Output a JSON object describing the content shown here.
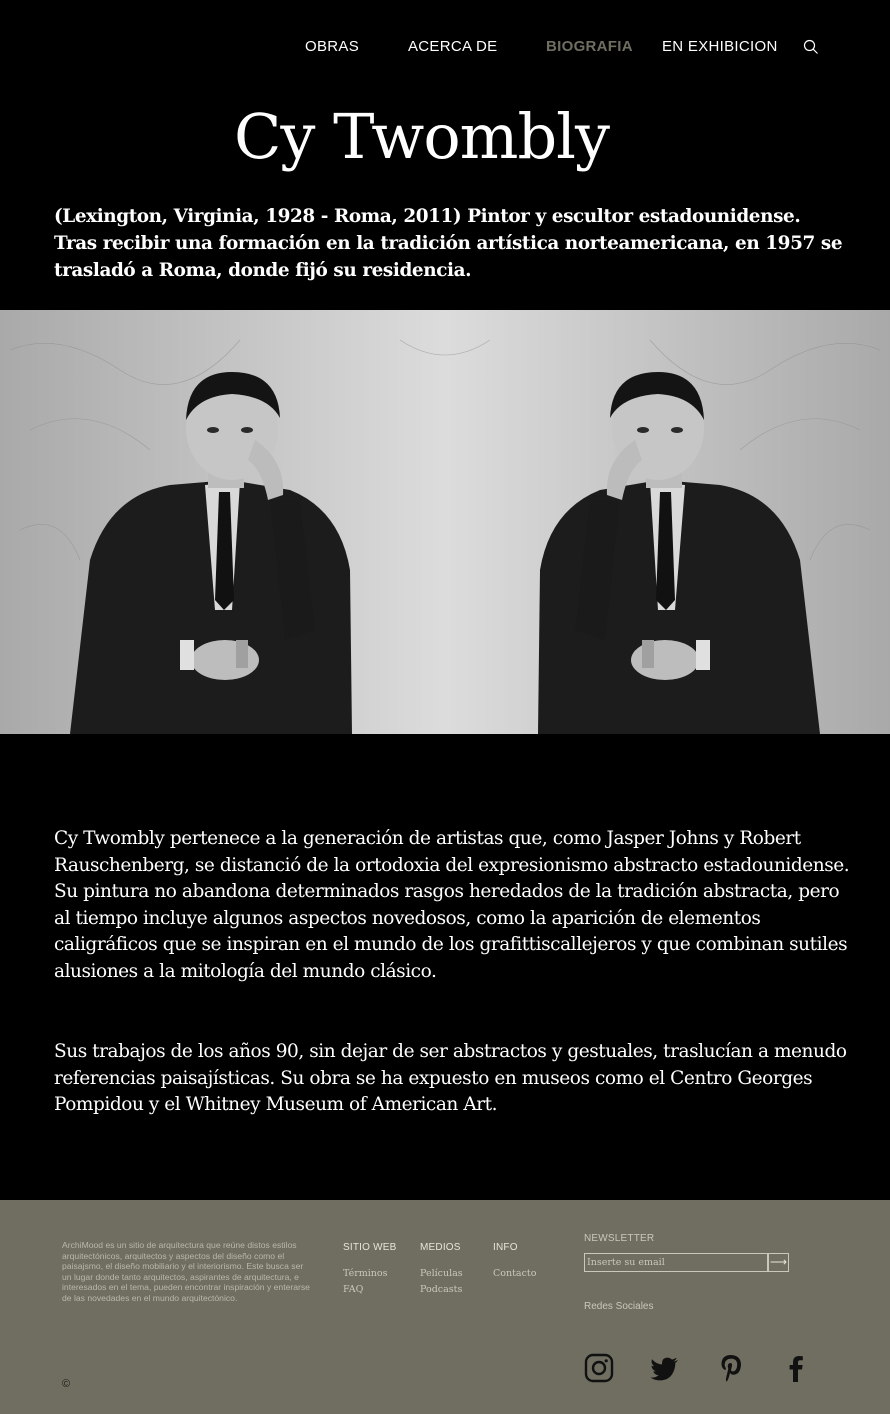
{
  "nav": {
    "items": [
      {
        "label": "OBRAS"
      },
      {
        "label": "ACERCA DE"
      },
      {
        "label": "BIOGRAFIA",
        "active": true
      },
      {
        "label": "EN EXHIBICION"
      }
    ],
    "search_icon": "search-icon",
    "active_color": "#6f6e60"
  },
  "hero": {
    "title": "Cy Twombly",
    "intro": "(Lexington, Virginia, 1928 - Roma, 2011) Pintor y escultor estadounidense. Tras recibir una formación en la tradición artística norteamericana, en 1957 se trasladó a Roma, donde fijó su residencia."
  },
  "body": {
    "paragraph_1": "Cy Twombly pertenece a la generación de artistas que, como Jasper Johns y Robert Rauschenberg, se distanció de la ortodoxia del expresionismo abstracto estadounidense. Su pintura no abandona determinados rasgos heredados de la tradición abstracta, pero al tiempo incluye algunos aspectos novedosos, como la aparición de elementos caligráficos que se inspiran en el mundo de los grafittiscallejeros y que combinan sutiles alusiones a la mitología del mundo clásico.",
    "paragraph_2": "Sus trabajos de los años 90, sin dejar de ser abstractos y gestuales, traslucían a menudo referencias paisajísticas. Su obra se ha expuesto en museos como el Centro Georges Pompidou y el Whitney Museum of American Art."
  },
  "footer": {
    "about": "ArchiMood es un sitio de arquitectura que reúne distos estilos arquitectónicos, arquitectos y aspectos del diseño como el paisajsmo, el diseño mobiliario y el interiorismo. Este busca ser un lugar donde tanto arquitectos, aspirantes de arquitectura, e interesados en el tema, pueden encontrar inspiración y enterarse de las novedades en el mundo arquitectónico.",
    "columns": [
      {
        "title": "SITIO WEB",
        "links": [
          "Términos",
          "FAQ"
        ]
      },
      {
        "title": "MEDIOS",
        "links": [
          "Películas",
          "Podcasts"
        ]
      },
      {
        "title": "INFO",
        "links": [
          "Contacto"
        ]
      }
    ],
    "newsletter": {
      "label": "NEWSLETTER",
      "placeholder": "Inserte su email",
      "submit_icon": "arrow-right-icon"
    },
    "social_label": "Redes Sociales",
    "social_icons": [
      "instagram-icon",
      "twitter-icon",
      "pinterest-icon",
      "facebook-icon"
    ],
    "copyright": "©",
    "background_color": "#6f6e60"
  }
}
